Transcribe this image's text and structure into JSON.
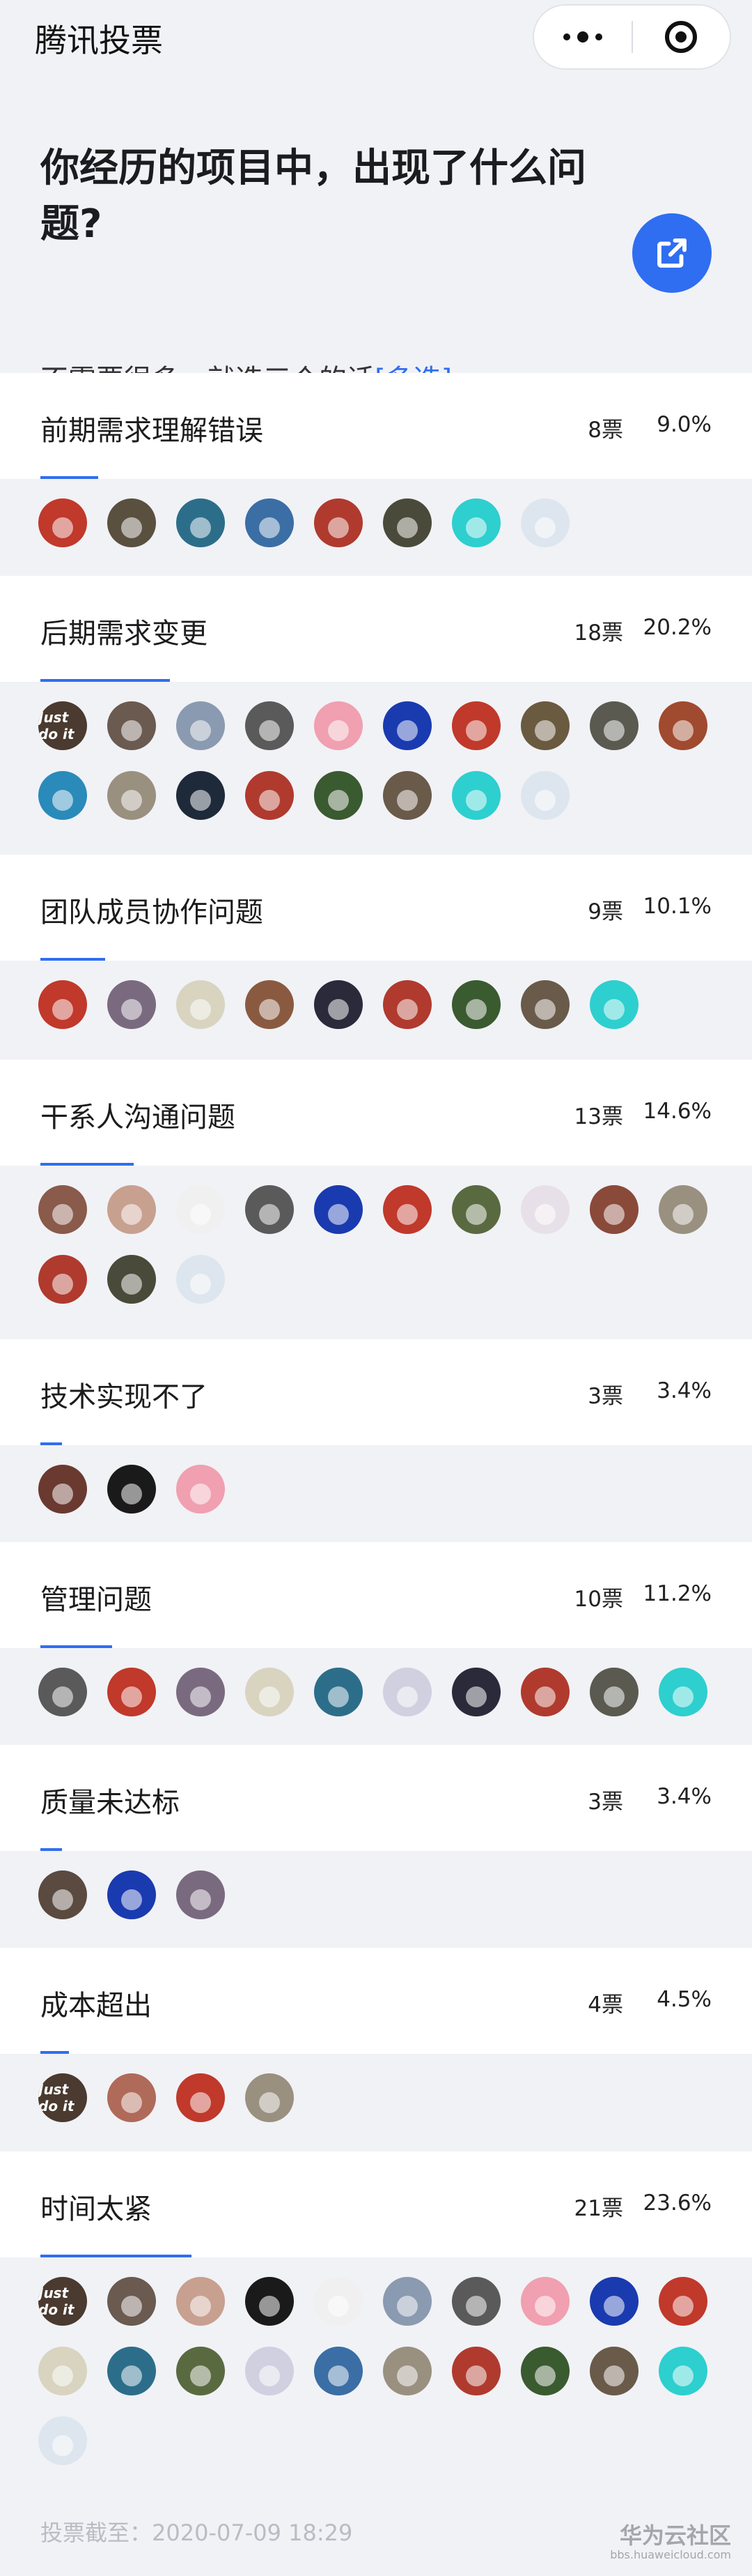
{
  "app": {
    "title": "腾讯投票"
  },
  "capsule": {
    "more_icon": "more-dots-icon",
    "close_icon": "target-circle-icon"
  },
  "question": {
    "title": "你经历的项目中，出现了什么问题?",
    "subtitle": "不需要很多，就选三个的话",
    "type_tag": "[多选]",
    "share_icon": "external-link-icon"
  },
  "colors": {
    "accent": "#2f6ef0",
    "background": "#f1f2f6",
    "card": "#ffffff"
  },
  "options": [
    {
      "label": "前期需求理解错误",
      "votes": "8票",
      "percent": "9.0%",
      "share": 0.09,
      "voters": [
        "#c0392b",
        "#5a5040",
        "#2c6e8a",
        "#3a6ea5",
        "#b03a2e",
        "#4a4a3a",
        "#2ecfcf",
        "#dde6ee"
      ]
    },
    {
      "label": "后期需求变更",
      "votes": "18票",
      "percent": "20.2%",
      "share": 0.202,
      "voters": [
        "#4a3a30",
        "#6a5a50",
        "#8a9ab0",
        "#5a5a5a",
        "#f0a0b0",
        "#1a3ab0",
        "#c0392b",
        "#6a5a40",
        "#5a5a50",
        "#a04a30",
        "#2a8aba",
        "#9a9080",
        "#1e2a3a",
        "#b03a2e",
        "#3a5a30",
        "#6a5a4a",
        "#2ecfcf",
        "#dde6ee"
      ]
    },
    {
      "label": "团队成员协作问题",
      "votes": "9票",
      "percent": "10.1%",
      "share": 0.101,
      "voters": [
        "#c0392b",
        "#7a6a80",
        "#d8d4c0",
        "#8a5a40",
        "#2a2a3a",
        "#b03a2e",
        "#3a5a30",
        "#6a5a4a",
        "#2ecfcf"
      ]
    },
    {
      "label": "干系人沟通问题",
      "votes": "13票",
      "percent": "14.6%",
      "share": 0.146,
      "voters": [
        "#8a5a4a",
        "#c8a090",
        "#f0f0f0",
        "#5a5a5a",
        "#1a3ab0",
        "#c0392b",
        "#5a6a40",
        "#e8e0e8",
        "#8a4a3a",
        "#9a9080",
        "#b03a2e",
        "#4a4a3a",
        "#dde6ee"
      ]
    },
    {
      "label": "技术实现不了",
      "votes": "3票",
      "percent": "3.4%",
      "share": 0.034,
      "voters": [
        "#6a3a30",
        "#1a1a1a",
        "#f0a0b0"
      ]
    },
    {
      "label": "管理问题",
      "votes": "10票",
      "percent": "11.2%",
      "share": 0.112,
      "voters": [
        "#5a5a5a",
        "#c0392b",
        "#7a6a80",
        "#d8d4c0",
        "#2c6e8a",
        "#d0d0e0",
        "#2a2a3a",
        "#b03a2e",
        "#5a5a50",
        "#2ecfcf"
      ]
    },
    {
      "label": "质量未达标",
      "votes": "3票",
      "percent": "3.4%",
      "share": 0.034,
      "voters": [
        "#5a4a40",
        "#1a3ab0",
        "#7a6a80"
      ]
    },
    {
      "label": "成本超出",
      "votes": "4票",
      "percent": "4.5%",
      "share": 0.045,
      "voters": [
        "#4a3a30",
        "#b06a5a",
        "#c0392b",
        "#9a9080"
      ]
    },
    {
      "label": "时间太紧",
      "votes": "21票",
      "percent": "23.6%",
      "share": 0.236,
      "voters": [
        "#4a3a30",
        "#6a5a50",
        "#c8a090",
        "#1a1a1a",
        "#f0f0f0",
        "#8a9ab0",
        "#5a5a5a",
        "#f0a0b0",
        "#1a3ab0",
        "#c0392b",
        "#d8d4c0",
        "#2c6e8a",
        "#5a6a40",
        "#d0d0e0",
        "#3a6ea5",
        "#9a9080",
        "#b03a2e",
        "#3a5a30",
        "#6a5a4a",
        "#2ecfcf",
        "#dde6ee"
      ]
    }
  ],
  "avatar_text": "Just do it",
  "footer": {
    "deadline": "投票截至：2020-07-09 18:29"
  },
  "watermark": {
    "brand": "华为云社区",
    "url": "bbs.huaweicloud.com"
  }
}
